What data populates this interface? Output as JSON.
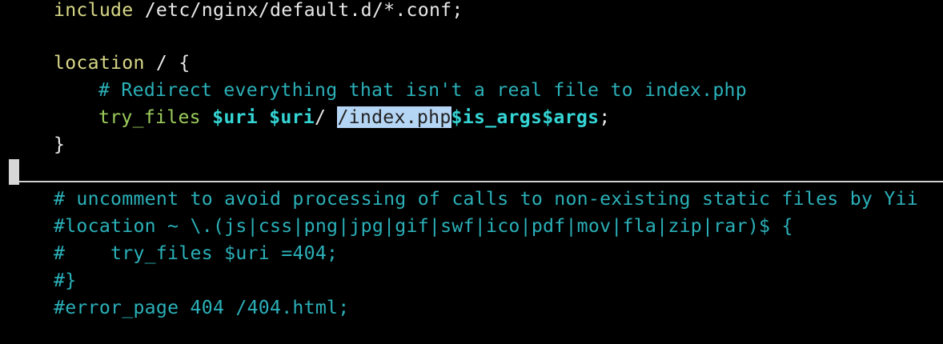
{
  "editor": {
    "line1": {
      "keyword": "include",
      "text": " /etc/nginx/default.d/*.conf;"
    },
    "line3": {
      "keyword": "location",
      "text": " / {"
    },
    "line4": {
      "comment": "# Redirect everything that isn't a real file to index.php"
    },
    "line5": {
      "directive": "try_files",
      "sp1": " ",
      "var1": "$uri",
      "sp2": " ",
      "var2": "$uri",
      "slash": "/ ",
      "selected": "/index.php",
      "var3": "$is_args$args",
      "end": ";"
    },
    "line6": {
      "text": "}"
    },
    "line8": {
      "comment": "# uncomment to avoid processing of calls to non-existing static files by Yii"
    },
    "line9": {
      "comment": "#location ~ \\.(js|css|png|jpg|gif|swf|ico|pdf|mov|fla|zip|rar)$ {"
    },
    "line10": {
      "comment": "#    try_files $uri =404;"
    },
    "line11": {
      "comment": "#}"
    },
    "line12": {
      "comment": "#error_page 404 /404.html;"
    }
  },
  "colors": {
    "background": "#000000",
    "keyword": "#d7d787",
    "directive": "#9ccc5c",
    "variable": "#35d4d4",
    "comment": "#2bb0b8",
    "selection": "#b5d5f5"
  }
}
